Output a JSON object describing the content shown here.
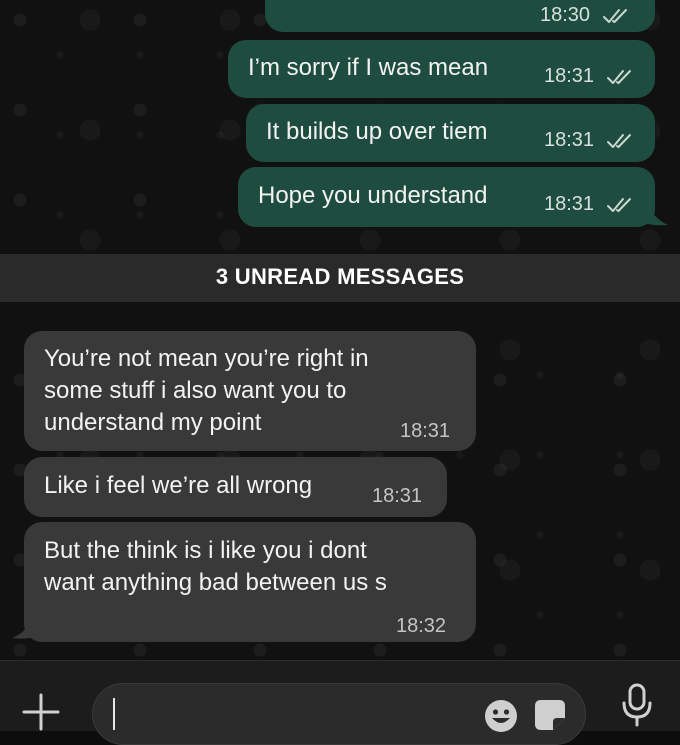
{
  "colors": {
    "outgoing_bubble": "#1e4d3f",
    "incoming_bubble": "#393939",
    "chat_background": "#111111",
    "divider_background": "#2a2a2a"
  },
  "outgoing_messages": [
    {
      "text": "",
      "time": "18:30",
      "status": "read"
    },
    {
      "text": "I’m sorry if I was mean",
      "time": "18:31",
      "status": "read"
    },
    {
      "text": "It builds up over tiem",
      "time": "18:31",
      "status": "read"
    },
    {
      "text": "Hope you understand",
      "time": "18:31",
      "status": "read"
    }
  ],
  "unread_divider": "3 UNREAD MESSAGES",
  "incoming_messages": [
    {
      "text": "You’re not mean you’re right in\nsome stuff i also want you to\nunderstand my point",
      "time": "18:31"
    },
    {
      "text": "Like i feel we’re all wrong",
      "time": "18:31"
    },
    {
      "text": "But the think is i like you i dont\nwant anything bad between us s",
      "time": "18:32"
    }
  ],
  "composer": {
    "input_value": "",
    "icons": [
      "plus-icon",
      "emoji-icon",
      "sticker-icon",
      "microphone-icon"
    ]
  }
}
